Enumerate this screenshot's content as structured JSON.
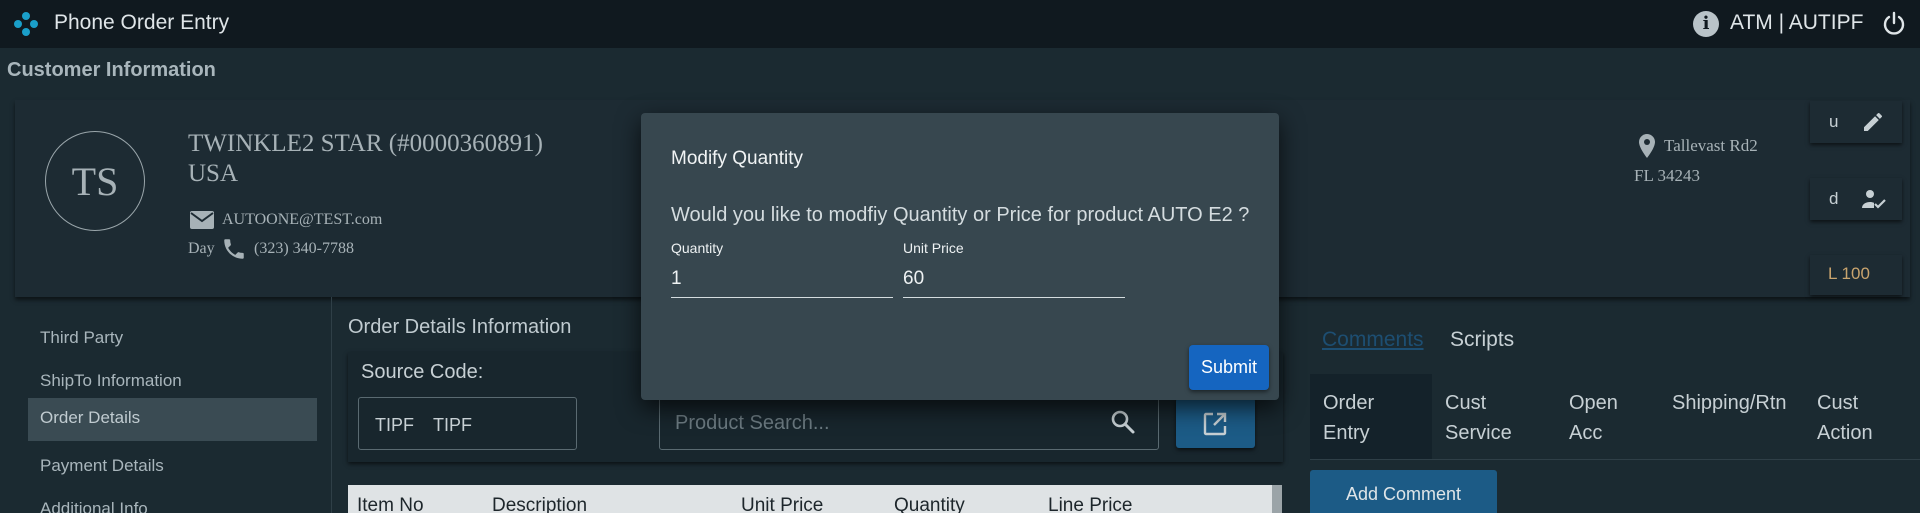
{
  "header": {
    "title": "Phone Order Entry",
    "user": "ATM | AUTIPF"
  },
  "customer_section": {
    "title": "Customer Information",
    "initials": "TS",
    "name": "TWINKLE2 STAR (#0000360891)",
    "country": "USA",
    "email": "AUTOONE@TEST.com",
    "phone_label": "Day",
    "phone": "(323) 340-7788",
    "address_line1": "Tallevast Rd2",
    "address_line2": "FL 34243",
    "edit_button_label": "u",
    "verify_button_label": "d",
    "limit": "L 100"
  },
  "left_nav": {
    "items": [
      {
        "label": "Third Party"
      },
      {
        "label": "ShipTo Information"
      },
      {
        "label": "Order Details"
      },
      {
        "label": "Payment Details"
      },
      {
        "label": "Additional Info"
      }
    ],
    "active_index": 2
  },
  "order_details": {
    "title": "Order Details Information",
    "source_code_label": "Source Code:",
    "source_code_values": [
      "TIPF",
      "TIPF"
    ],
    "product_search_placeholder": "Product Search...",
    "columns": [
      "Item No",
      "Description",
      "Unit Price",
      "Quantity",
      "Line Price"
    ]
  },
  "right_panel": {
    "tabs": [
      "Comments",
      "Scripts"
    ],
    "active_tab": "Comments",
    "order_tabs": [
      "Order Entry",
      "Cust Service",
      "Open Acc",
      "Shipping/Rtn",
      "Cust Action"
    ],
    "active_order_tab": "Order Entry",
    "add_comment_label": "Add Comment"
  },
  "dialog": {
    "title": "Modify Quantity",
    "message": "Would you like to modfiy Quantity or Price for product AUTO E2 ?",
    "quantity_label": "Quantity",
    "quantity_value": "1",
    "unit_price_label": "Unit Price",
    "unit_price_value": "60",
    "submit_label": "Submit"
  },
  "colors": {
    "accent": "#1565c0",
    "button_blue": "#1c5b86",
    "limit_text": "#c9a46e",
    "background": "#1b2a31"
  },
  "icons": {
    "logo": "app-logo-icon",
    "info": "info-icon",
    "power": "power-icon",
    "email": "email-icon",
    "phone": "phone-icon",
    "location": "location-pin-icon",
    "edit": "pencil-icon",
    "verify": "person-check-icon",
    "search": "search-icon",
    "open": "open-in-new-icon"
  }
}
